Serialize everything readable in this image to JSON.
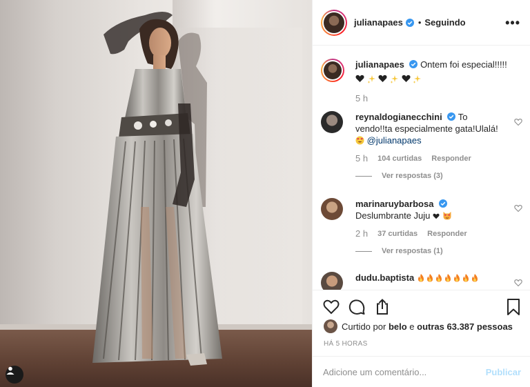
{
  "post": {
    "author": "julianapaes",
    "follow_status": "Seguindo",
    "separator": "•",
    "more_icon": "more-options-icon",
    "caption": {
      "username": "julianapaes",
      "text": "Ontem foi especial!!!!!",
      "emojis": [
        "black-heart",
        "sparkles",
        "black-heart",
        "sparkles",
        "black-heart",
        "sparkles"
      ],
      "time": "5 h"
    }
  },
  "comments": [
    {
      "username": "reynaldogianecchini",
      "verified": true,
      "text": "To vendo!!ta especialmente gata!Ulalá!",
      "emoji": "heart-eyes-face",
      "mention": "@julianapaes",
      "time": "5 h",
      "likes": "104 curtidas",
      "reply": "Responder",
      "view_replies": "Ver respostas (3)"
    },
    {
      "username": "marinaruybarbosa",
      "verified": true,
      "text": "Deslumbrante Juju",
      "emoji": "heart-cat",
      "time": "2 h",
      "likes": "37 curtidas",
      "reply": "Responder",
      "view_replies": "Ver respostas (1)"
    },
    {
      "username": "dudu.baptista",
      "verified": false,
      "emoji": "fire",
      "emoji_count": 7
    }
  ],
  "likes_line": {
    "prefix": "Curtido por",
    "user": "belo",
    "conjunction": "e",
    "others": "outras 63.387 pessoas"
  },
  "timestamp": "Há 5 horas",
  "add_comment": {
    "placeholder": "Adicione um comentário...",
    "publish": "Publicar"
  },
  "colors": {
    "text": "#262626",
    "muted": "#8e8e8e",
    "verified": "#3897f0",
    "publish_disabled": "#b2dffc",
    "mention": "#00376b"
  }
}
